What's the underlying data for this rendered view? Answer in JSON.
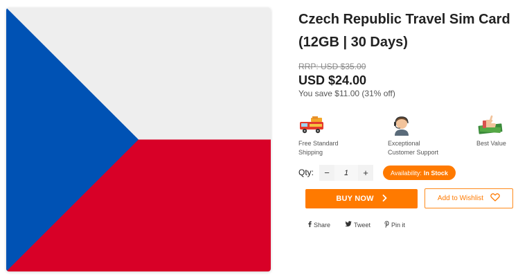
{
  "product": {
    "title": "Czech Republic Travel Sim Card (12GB | 30 Days)",
    "rrp": "RRP: USD $35.00",
    "price": "USD $24.00",
    "savings": "You save $11.00 (31% off)",
    "image_alt": "Czech Republic flag"
  },
  "features": [
    {
      "icon": "delivery-truck-icon",
      "label": "Free Standard\nShipping"
    },
    {
      "icon": "support-agent-icon",
      "label": "Exceptional\nCustomer Support"
    },
    {
      "icon": "thumbs-up-money-icon",
      "label": "Best Value"
    }
  ],
  "quantity": {
    "label": "Qty:",
    "value": "1",
    "minus": "−",
    "plus": "+"
  },
  "availability": {
    "prefix": "Availability:",
    "status": "In Stock"
  },
  "actions": {
    "buy_now": "BUY NOW",
    "wishlist": "Add to Wishlist"
  },
  "share": [
    {
      "icon": "facebook-icon",
      "label": "Share"
    },
    {
      "icon": "twitter-icon",
      "label": "Tweet"
    },
    {
      "icon": "pinterest-icon",
      "label": "Pin it"
    }
  ],
  "colors": {
    "accent": "#ff7a00",
    "flag_white": "#eeeeee",
    "flag_red": "#d80027",
    "flag_blue": "#0052b4"
  }
}
